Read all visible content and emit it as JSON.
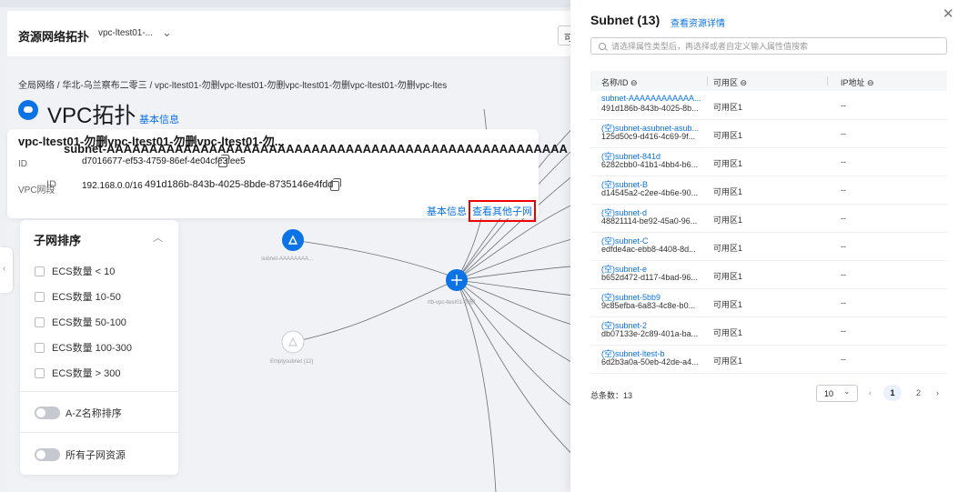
{
  "header": {
    "title": "资源网络拓扑",
    "vpc_select": "vpc-ltest01-...",
    "avail_btn": "可"
  },
  "breadcrumb": "全局网络 / 华北-乌兰察布二零三 / vpc-ltest01-勿删vpc-ltest01-勿删vpc-ltest01-勿删vpc-ltest01-勿删vpc-ltes",
  "vpc": {
    "title": "VPC拓扑",
    "basic_info": "基本信息",
    "name": "vpc-ltest01-勿删vpc-ltest01-勿删vpc-ltest01-勿..."
  },
  "subnet_card": {
    "title": "subnet-AAAAAAAAAAAAAAAAAAAAAAAAAAAAAAAAAAAAAAAAAAAAAAAAAAAAAA",
    "id_label": "ID",
    "id_value": "d7016677-ef53-4759-86ef-4e04cfe3fee5",
    "vpc_seg_label": "VPC网段",
    "id_label2": "ID",
    "cidr": "192.168.0.0/16",
    "subnet_id": "491d186b-843b-4025-8bde-8735146e4fdd",
    "basic_info": "基本信息",
    "other_subnets": "查看其他子网"
  },
  "sort_panel": {
    "title": "子网排序",
    "options": [
      "ECS数量 < 10",
      "ECS数量 10-50",
      "ECS数量 50-100",
      "ECS数量 100-300",
      "ECS数量 > 300"
    ],
    "toggle_az": "A-Z名称排序",
    "toggle_all": "所有子网资源"
  },
  "topology": {
    "node_subnet": "subnet-AAAAAAAA...",
    "node_router": "rtb-vpc-ltest01-勿删",
    "node_empty": "Emptysubnet (12)"
  },
  "drawer": {
    "title": "Subnet (13)",
    "detail_link": "查看资源详情",
    "search_placeholder": "请选择属性类型后，再选择或者自定义输入属性值搜索",
    "columns": [
      "名称/ID ⊖",
      "可用区 ⊖",
      "IP地址 ⊖"
    ],
    "rows": [
      {
        "name": "subnet-AAAAAAAAAAAA...",
        "id": "491d186b-843b-4025-8b...",
        "az": "可用区1",
        "ip": "--"
      },
      {
        "name": "(空)subnet-asubnet-asub...",
        "id": "125d50c9-d416-4c69-9f...",
        "az": "可用区1",
        "ip": "--"
      },
      {
        "name": "(空)subnet-841d",
        "id": "6282cbb0-41b1-4bb4-b6...",
        "az": "可用区1",
        "ip": "--"
      },
      {
        "name": "(空)subnet-B",
        "id": "d14545a2-c2ee-4b6e-90...",
        "az": "可用区1",
        "ip": "--"
      },
      {
        "name": "(空)subnet-d",
        "id": "48821114-be92-45a0-96...",
        "az": "可用区1",
        "ip": "--"
      },
      {
        "name": "(空)subnet-C",
        "id": "edfde4ac-ebb8-4408-8d...",
        "az": "可用区1",
        "ip": "--"
      },
      {
        "name": "(空)subnet-e",
        "id": "b652d472-d117-4bad-96...",
        "az": "可用区1",
        "ip": "--"
      },
      {
        "name": "(空)subnet-5bb9",
        "id": "9c85efba-6a83-4c8e-b0...",
        "az": "可用区1",
        "ip": "--"
      },
      {
        "name": "(空)subnet-2",
        "id": "db07133e-2c89-401a-ba...",
        "az": "可用区1",
        "ip": "--"
      },
      {
        "name": "(空)subnet-ltest-b",
        "id": "6d2b3a0a-50eb-42de-a4...",
        "az": "可用区1",
        "ip": "--"
      }
    ],
    "total": "总条数：13",
    "page_size": "10",
    "pages": [
      "1",
      "2"
    ]
  }
}
